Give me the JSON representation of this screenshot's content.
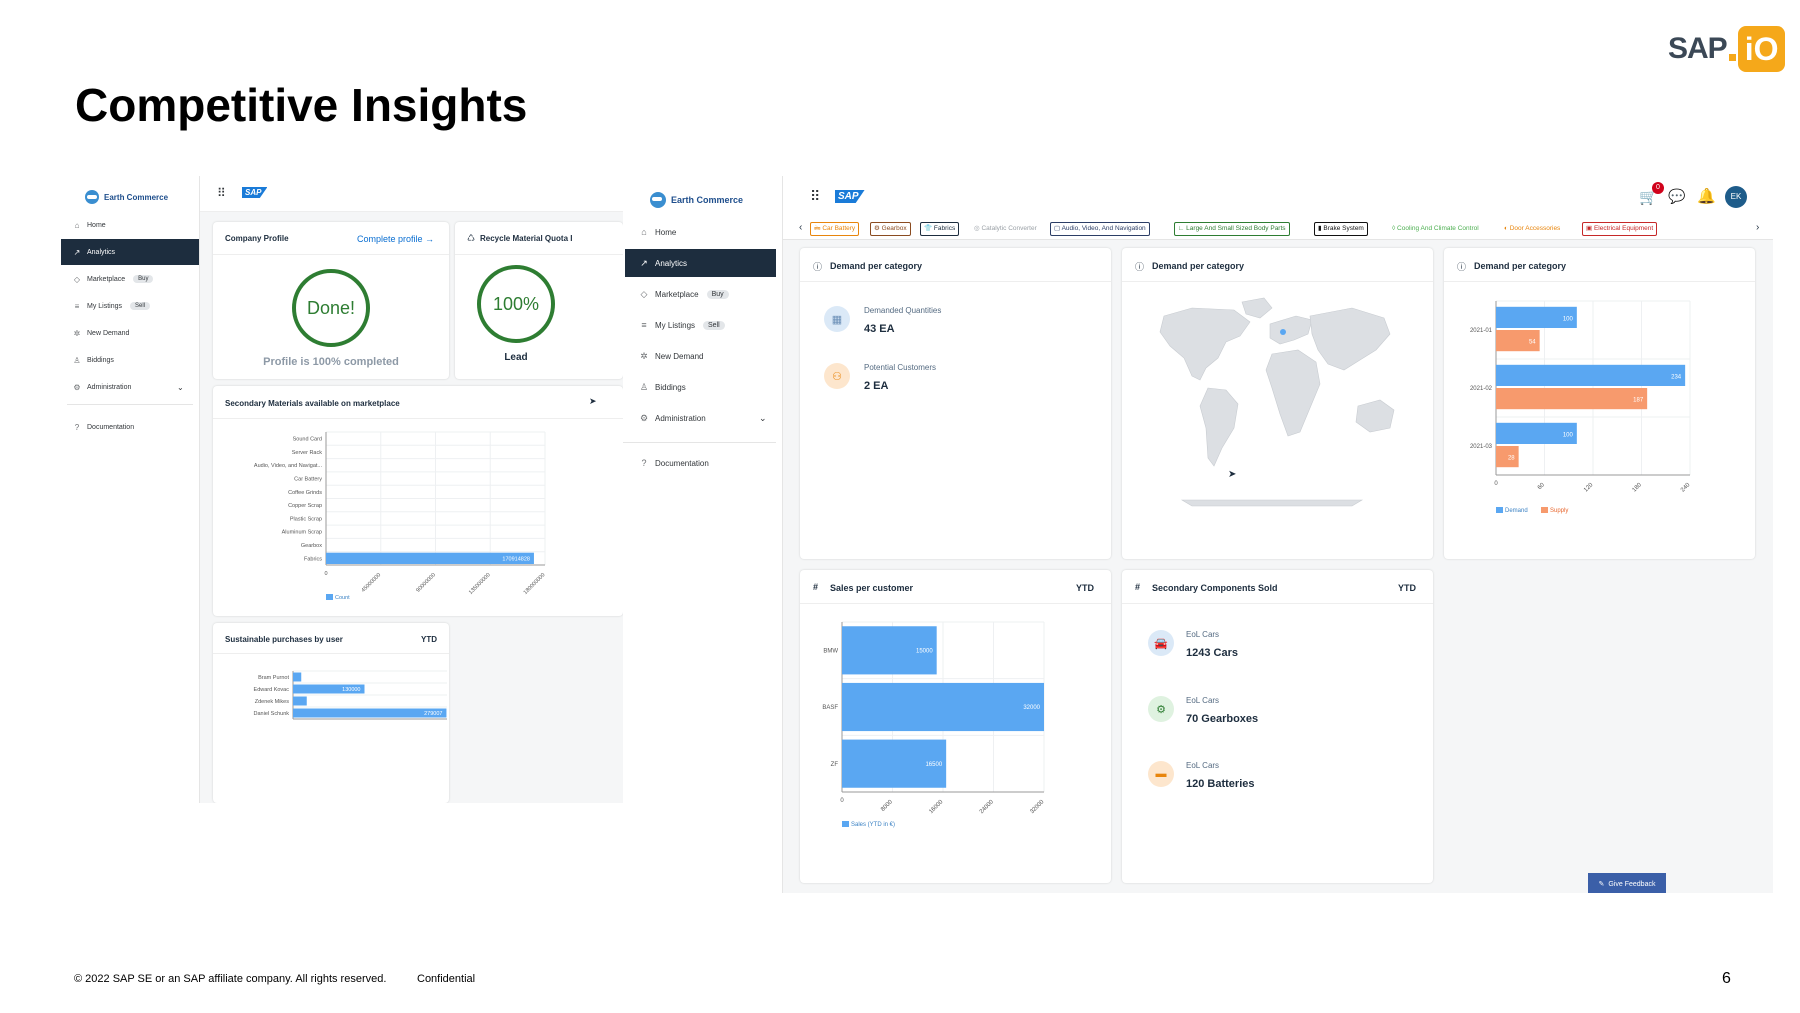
{
  "slide": {
    "title": "Competitive Insights",
    "logo_sap": "SAP",
    "logo_io": "iO",
    "footer": "© 2022 SAP SE or an SAP affiliate company. All rights reserved.",
    "confidential": "Confidential",
    "page_number": "6"
  },
  "app": {
    "brand": "Earth Commerce",
    "sap_logo": "SAP",
    "nav": [
      {
        "label": "Home",
        "icon": "home-icon"
      },
      {
        "label": "Analytics",
        "icon": "chart-icon"
      },
      {
        "label": "Marketplace",
        "icon": "tag-icon",
        "badge": "Buy"
      },
      {
        "label": "My Listings",
        "icon": "list-icon",
        "badge": "Sell"
      },
      {
        "label": "New Demand",
        "icon": "demand-icon"
      },
      {
        "label": "Biddings",
        "icon": "trophy-icon"
      },
      {
        "label": "Administration",
        "icon": "gear-icon"
      },
      {
        "label": "Documentation",
        "icon": "help-icon"
      }
    ]
  },
  "shot1": {
    "company_profile": {
      "title": "Company Profile",
      "link": "Complete profile →",
      "ring_text": "Done!",
      "status": "Profile is 100% completed",
      "progress": 1.0
    },
    "recycle": {
      "title": "Recycle Material Quota I",
      "ring_text": "100%",
      "caption": "Lead"
    },
    "secondary_materials": {
      "title": "Secondary Materials available on marketplace"
    },
    "sustainable": {
      "title": "Sustainable purchases by user",
      "ytd": "YTD"
    }
  },
  "shot3": {
    "user_initials": "EK",
    "cart_badge": "0",
    "categories": [
      {
        "label": "Car Battery",
        "color": "#e8850c",
        "icon": "🖮"
      },
      {
        "label": "Gearbox",
        "color": "#8a4b20",
        "icon": "⚙"
      },
      {
        "label": "Fabrics",
        "color": "#1d2d3e",
        "icon": "👕"
      },
      {
        "label": "Catalytic Converter",
        "color": "#9aa0a6",
        "icon": "◎"
      },
      {
        "label": "Audio, Video, And Navigation",
        "color": "#2c3e66",
        "icon": "▢"
      },
      {
        "label": "Large And Small Sized Body Parts",
        "color": "#2e7d32",
        "icon": "∟"
      },
      {
        "label": "Brake System",
        "color": "#111111",
        "icon": "▮"
      },
      {
        "label": "Cooling And Climate Control",
        "color": "#4caf50",
        "icon": "◊"
      },
      {
        "label": "Door Accessories",
        "color": "#e8850c",
        "icon": "◐"
      },
      {
        "label": "Electrical Equipment",
        "color": "#c62828",
        "icon": "▣"
      }
    ],
    "demand_card1": {
      "title": "Demand per category",
      "kpis": [
        {
          "label": "Demanded Quantities",
          "value": "43 EA"
        },
        {
          "label": "Potential Customers",
          "value": "2 EA"
        }
      ]
    },
    "demand_card2": {
      "title": "Demand per category"
    },
    "demand_card3": {
      "title": "Demand per category"
    },
    "sales_card": {
      "title": "Sales per customer",
      "ytd": "YTD"
    },
    "components_card": {
      "title": "Secondary Components Sold",
      "ytd": "YTD",
      "kpis": [
        {
          "label": "EoL Cars",
          "value": "1243 Cars"
        },
        {
          "label": "EoL Cars",
          "value": "70 Gearboxes"
        },
        {
          "label": "EoL Cars",
          "value": "120 Batteries"
        }
      ]
    },
    "feedback": "Give Feedback"
  },
  "chart_data": [
    {
      "id": "secondary-materials",
      "type": "bar",
      "orientation": "horizontal",
      "categories": [
        "Sound Card",
        "Server Rack",
        "Audio, Video, and Navigat...",
        "Car Battery",
        "Coffee Grinds",
        "Copper Scrap",
        "Plastic Scrap",
        "Aluminum Scrap",
        "Gearbox",
        "Fabrics"
      ],
      "series": [
        {
          "name": "Count",
          "values": [
            0,
            0,
            0,
            0,
            0,
            0,
            0,
            0,
            0,
            170914828
          ],
          "color": "#5aa7f2"
        }
      ],
      "data_labels": [
        "",
        "",
        "",
        "",
        "",
        "",
        "",
        "",
        "",
        "170914828"
      ],
      "xticks": [
        "0",
        "45000000",
        "90000000",
        "135000000",
        "180000000"
      ],
      "xlim": [
        0,
        180000000
      ],
      "legend": "bottom-left"
    },
    {
      "id": "sustainable-purchases",
      "type": "bar",
      "orientation": "horizontal",
      "categories": [
        "Bram Purnot",
        "Edward Kovac",
        "Zdenek Mikes",
        "Daniel Schunk"
      ],
      "series": [
        {
          "values": [
            15000,
            130000,
            25000,
            279007
          ],
          "color": "#5aa7f2"
        }
      ],
      "data_labels": [
        "",
        "130000",
        "",
        "279007"
      ],
      "xlim": [
        0,
        280000
      ]
    },
    {
      "id": "demand-by-month",
      "type": "bar",
      "orientation": "horizontal",
      "categories": [
        "2021-01",
        "2021-02",
        "2021-03"
      ],
      "series": [
        {
          "name": "Demand",
          "values": [
            100,
            234,
            100
          ],
          "color": "#5aa7f2"
        },
        {
          "name": "Supply",
          "values": [
            54,
            187,
            28
          ],
          "color": "#f79a6d"
        }
      ],
      "xticks": [
        "0",
        "60",
        "120",
        "180",
        "240"
      ],
      "xlim": [
        0,
        240
      ],
      "legend": "bottom-left"
    },
    {
      "id": "sales-per-customer",
      "type": "bar",
      "orientation": "horizontal",
      "categories": [
        "BMW",
        "BASF",
        "ZF"
      ],
      "series": [
        {
          "name": "Sales (YTD in €)",
          "values": [
            15000,
            32000,
            16500
          ],
          "color": "#5aa7f2"
        }
      ],
      "xticks": [
        "0",
        "8000",
        "16000",
        "24000",
        "32000"
      ],
      "xlim": [
        0,
        32000
      ],
      "legend": "bottom-left"
    }
  ]
}
